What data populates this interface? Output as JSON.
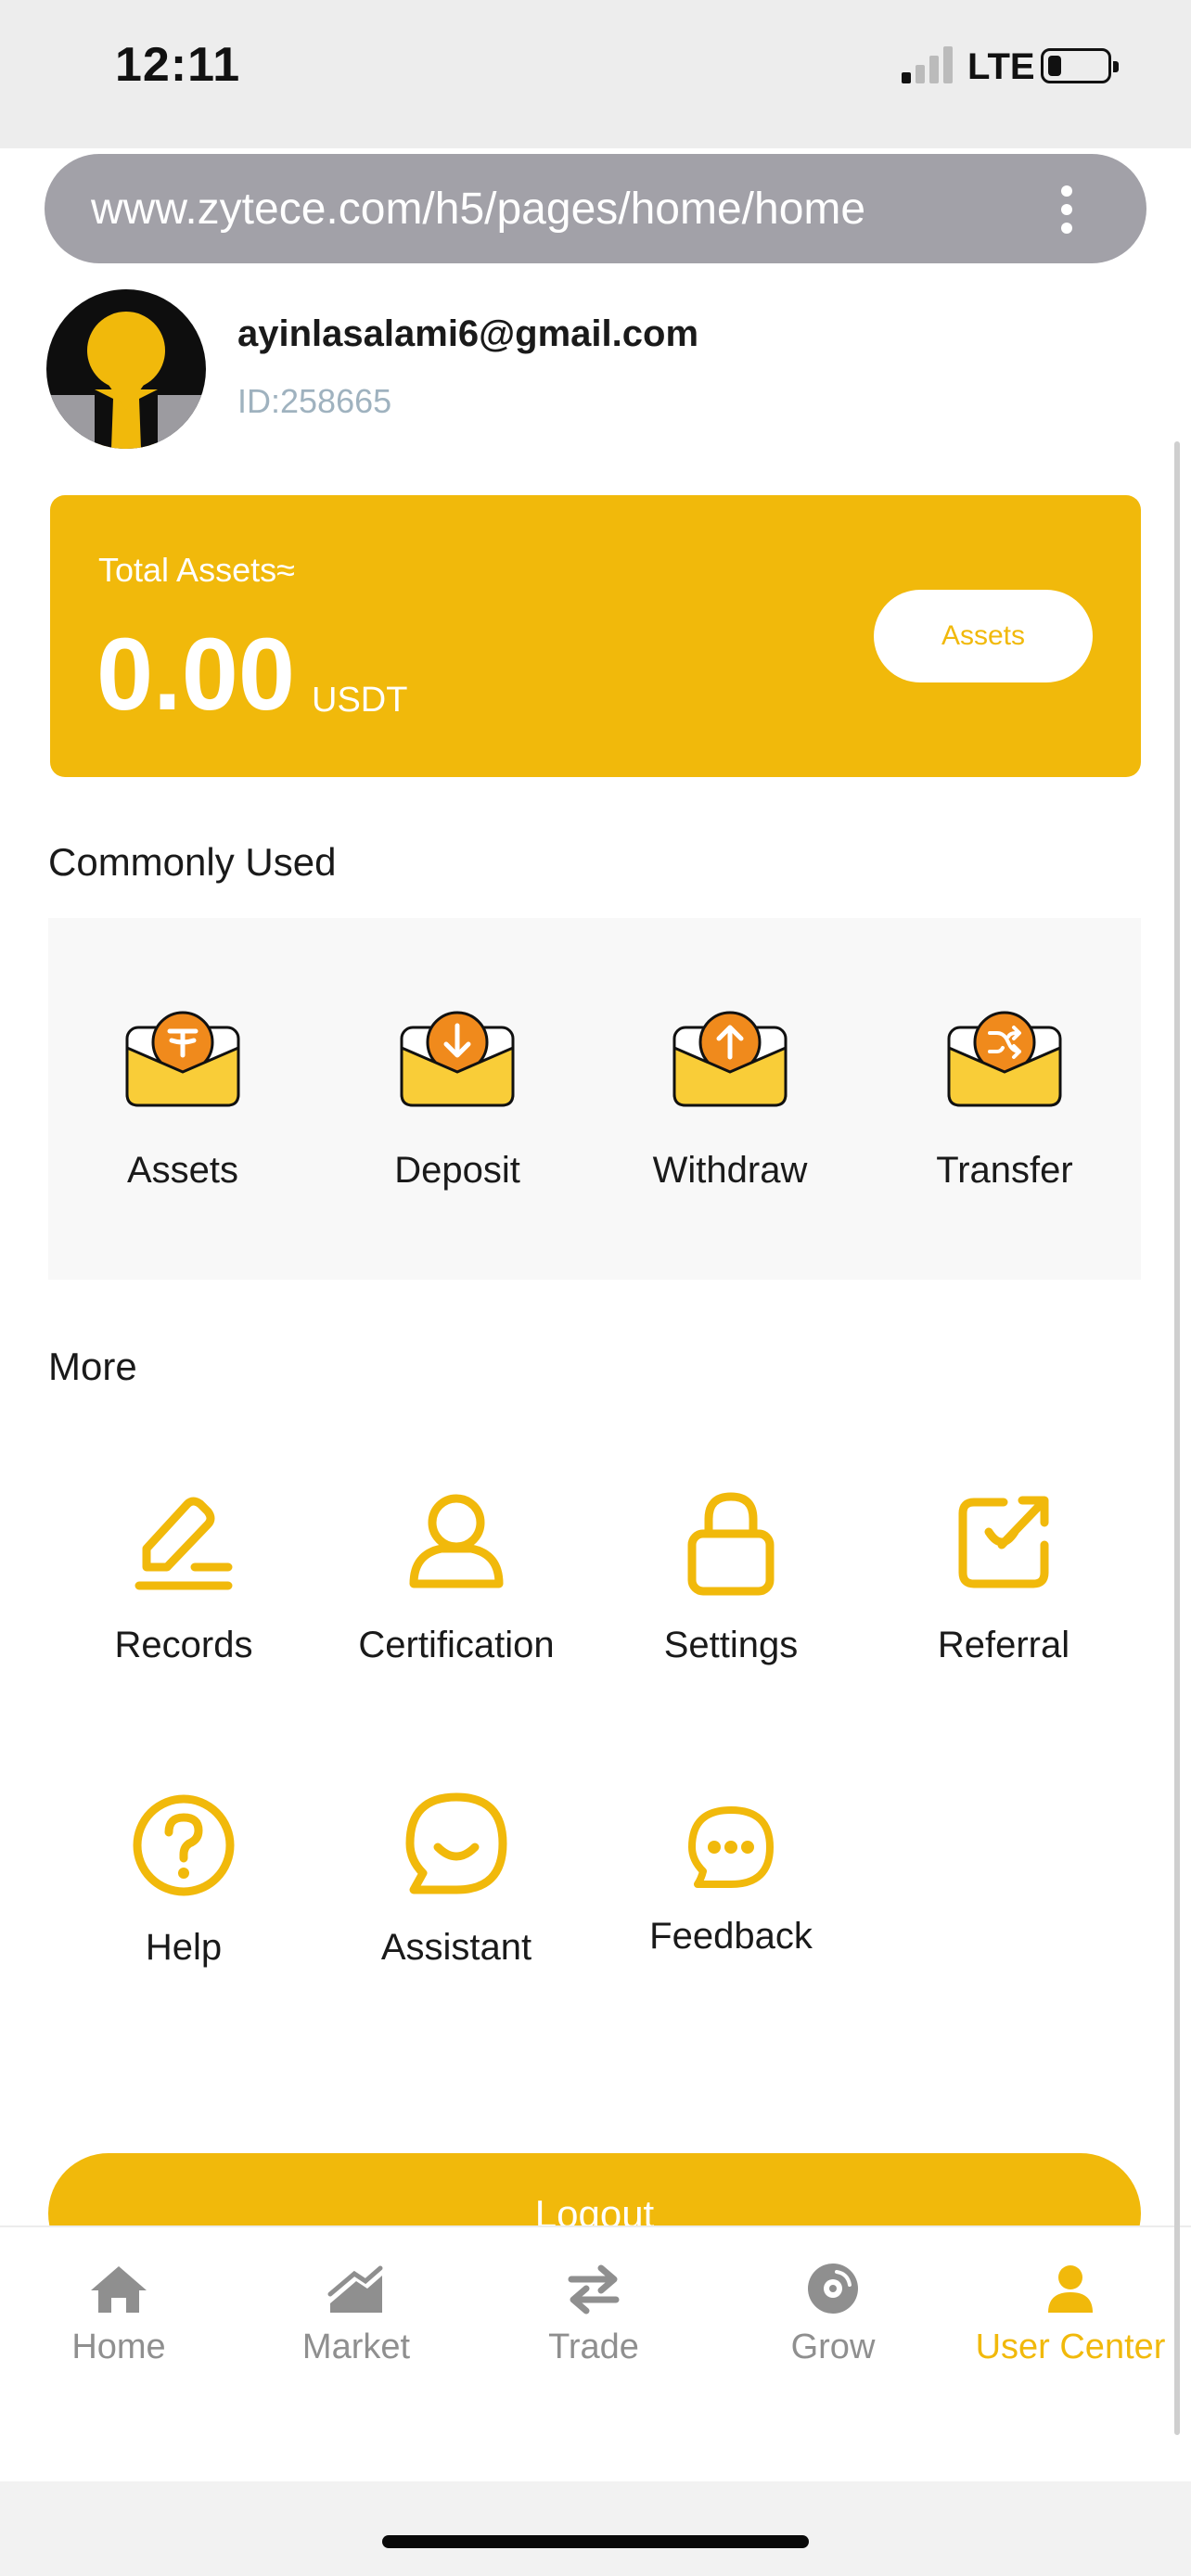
{
  "status_bar": {
    "time": "12:11",
    "network": "LTE"
  },
  "browser": {
    "url": "www.zytece.com/h5/pages/home/home"
  },
  "profile": {
    "email": "ayinlasalami6@gmail.com",
    "id": "ID:258665"
  },
  "assets_card": {
    "label": "Total Assets≈",
    "value": "0.00",
    "unit": "USDT",
    "button_label": "Assets"
  },
  "commonly_used": {
    "title": "Commonly Used",
    "items": [
      {
        "label": "Assets",
        "icon": "tether-wallet-icon"
      },
      {
        "label": "Deposit",
        "icon": "deposit-arrow-down-icon"
      },
      {
        "label": "Withdraw",
        "icon": "withdraw-arrow-up-icon"
      },
      {
        "label": "Transfer",
        "icon": "transfer-shuffle-icon"
      }
    ]
  },
  "more": {
    "title": "More",
    "items": [
      {
        "label": "Records",
        "icon": "pencil-edit-icon"
      },
      {
        "label": "Certification",
        "icon": "user-icon"
      },
      {
        "label": "Settings",
        "icon": "lock-icon"
      },
      {
        "label": "Referral",
        "icon": "share-arrow-icon"
      },
      {
        "label": "Help",
        "icon": "question-circle-icon"
      },
      {
        "label": "Assistant",
        "icon": "chat-smile-icon"
      },
      {
        "label": "Feedback",
        "icon": "chat-dots-icon"
      }
    ]
  },
  "logout_label": "Logout",
  "tabs": [
    {
      "label": "Home",
      "icon": "home-icon",
      "active": false
    },
    {
      "label": "Market",
      "icon": "market-chart-icon",
      "active": false
    },
    {
      "label": "Trade",
      "icon": "trade-swap-icon",
      "active": false
    },
    {
      "label": "Grow",
      "icon": "grow-disc-icon",
      "active": false
    },
    {
      "label": "User Center",
      "icon": "user-center-icon",
      "active": true
    }
  ],
  "colors": {
    "accent": "#f1b90b",
    "orange": "#f08a1c",
    "muted": "#8f8f8f",
    "id_text": "#9fb2bf"
  }
}
